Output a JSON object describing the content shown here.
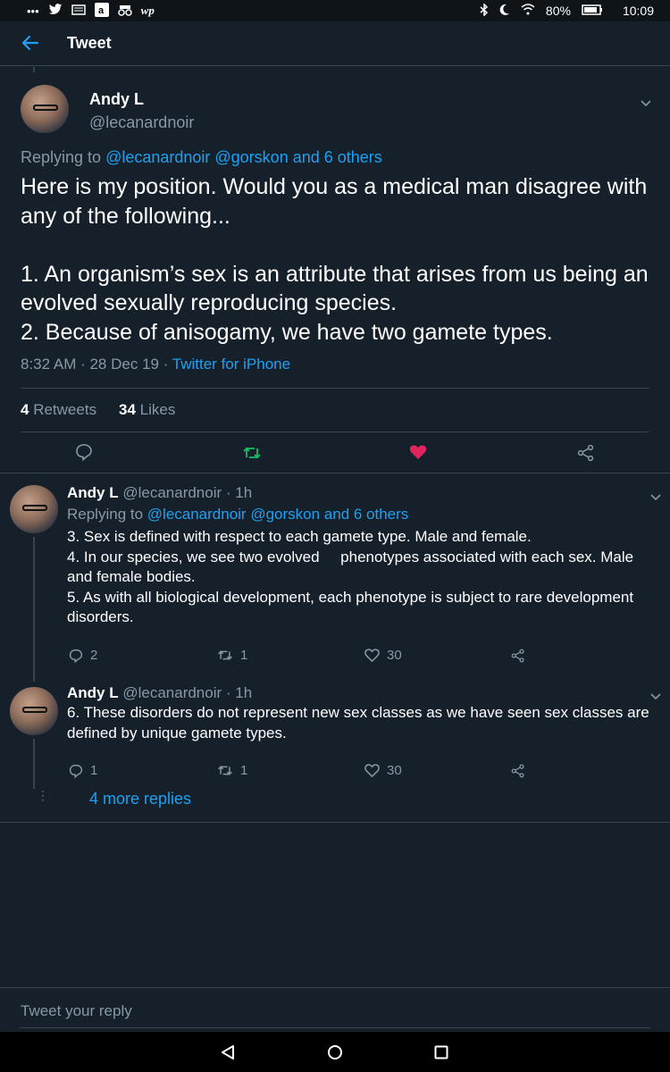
{
  "statusbar": {
    "battery": "80%",
    "time": "10:09"
  },
  "header": {
    "title": "Tweet"
  },
  "main_tweet": {
    "name": "Andy L",
    "handle": "@lecanardnoir",
    "replying_prefix": "Replying to ",
    "replying_users": "@lecanardnoir @gorskon and 6 others",
    "text": "Here is my position. Would you as a medical man disagree with any of the following...\n\n1. An organism’s sex is an attribute that arises from us being an evolved sexually reproducing species.\n2. Because of anisogamy, we have two gamete types.",
    "timestamp": "8:32 AM · 28 Dec 19 · ",
    "source": "Twitter for iPhone",
    "retweets_count": "4",
    "retweets_label": "Retweets",
    "likes_count": "34",
    "likes_label": "Likes"
  },
  "replies": [
    {
      "name": "Andy L",
      "handle_time": "@lecanardnoir · 1h",
      "replying_prefix": "Replying to ",
      "replying_users": "@lecanardnoir @gorskon and 6 others",
      "text": "3. Sex is defined with respect to each gamete type. Male and female.\n4. In our species, we see two evolved     phenotypes associated with each sex. Male and female bodies.\n5. As with all biological development, each phenotype is subject to rare development disorders.",
      "reply_count": "2",
      "retweet_count": "1",
      "like_count": "30"
    },
    {
      "name": "Andy L",
      "handle_time": "@lecanardnoir · 1h",
      "text": "6. These disorders do not represent new sex classes as we have seen sex classes are defined by unique gamete types.",
      "reply_count": "1",
      "retweet_count": "1",
      "like_count": "30"
    }
  ],
  "more_replies": "4 more replies",
  "reply_box": {
    "placeholder": "Tweet your reply"
  },
  "colors": {
    "background": "#15202b",
    "accent": "#1da1f2",
    "retweet_green": "#17bf63",
    "like_pink": "#e0245e",
    "muted": "#8899a6"
  }
}
